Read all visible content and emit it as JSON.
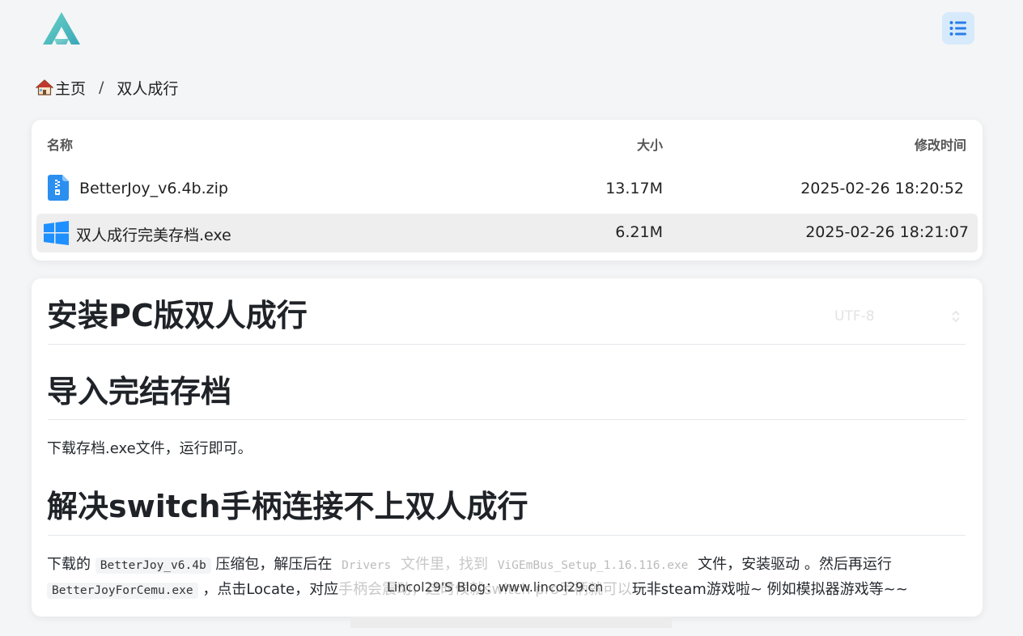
{
  "header": {
    "logo_icon": "logo-triangle-icon",
    "menu_icon": "list-menu-icon"
  },
  "breadcrumb": {
    "home_icon": "house-icon",
    "home_label": "主页",
    "separator": "/",
    "current": "双人成行"
  },
  "file_table": {
    "headers": {
      "name": "名称",
      "size": "大小",
      "time": "修改时间"
    },
    "rows": [
      {
        "icon": "zip-file-icon",
        "name": "BetterJoy_v6.4b.zip",
        "size": "13.17M",
        "time": "2025-02-26 18:20:52"
      },
      {
        "icon": "windows-exe-icon",
        "name": "双人成行完美存档.exe",
        "size": "6.21M",
        "time": "2025-02-26 18:21:07"
      }
    ]
  },
  "content": {
    "encoding": "UTF-8",
    "h1_install": "安装PC版双人成行",
    "h1_import": "导入完结存档",
    "p_import": "下载存档.exe文件，运行即可。",
    "h1_fix": "解决switch手柄连接不上双人成行",
    "p_fix": {
      "t1": "下载的 ",
      "c1": "BetterJoy_v6.4b",
      "t2": " 压缩包，解压后在 ",
      "c2": "Drivers",
      "t3": " 文件里，找到 ",
      "c3": "ViGEmBus_Setup_1.16.116.exe",
      "t4": " 文件，安装驱动 。然后再运行",
      "c4": "BetterJoyForCemu.exe",
      "t5": " ，点击Locate，对应",
      "t6": "手柄会震动，这时候就switch pro手柄就可以",
      "t7": "玩非steam游戏啦~ 例如模拟器游戏等~~"
    }
  },
  "watermark": "Lincol29'S Blog：www.lincol29.cn",
  "colors": {
    "accent": "#2b7de9",
    "logo_teal": "#4fc2b4",
    "menu_bg": "#d6eafc"
  }
}
